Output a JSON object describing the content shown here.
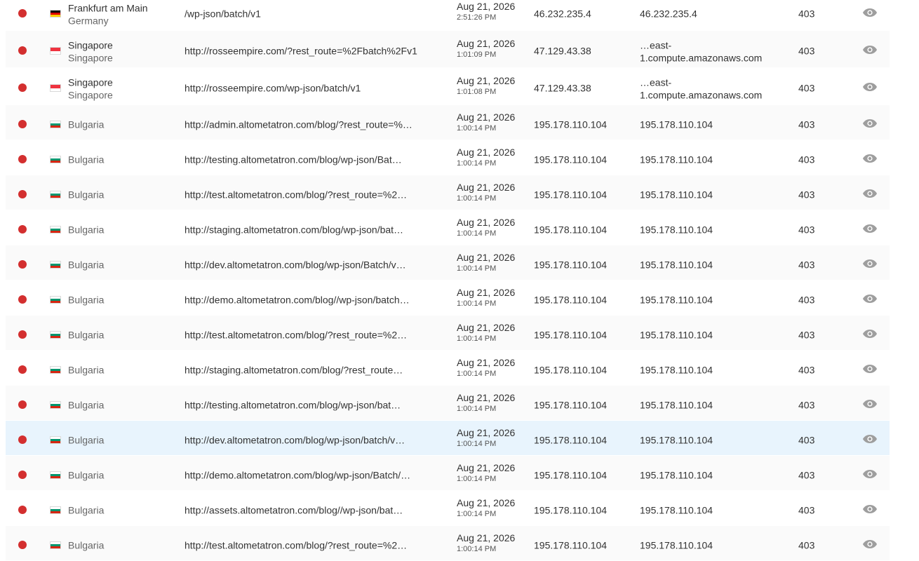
{
  "colors": {
    "status_dot": "#d32f2f",
    "highlight_row": "#e8f4fd",
    "eye_icon": "#9e9e9e"
  },
  "rows": [
    {
      "city": "Frankfurt am Main",
      "country": "Germany",
      "flag": "germany-flag-icon",
      "url": "/wp-json/batch/v1",
      "date": "Aug 21, 2026",
      "time": "2:51:26 PM",
      "ip": "46.232.235.4",
      "host": [
        "46.232.235.4"
      ],
      "code": "403"
    },
    {
      "city": "Singapore",
      "country": "Singapore",
      "flag": "singapore-flag-icon",
      "url": "http://rosseempire.com/?rest_route=%2Fbatch%2Fv1",
      "date": "Aug 21, 2026",
      "time": "1:01:09 PM",
      "ip": "47.129.43.38",
      "host": [
        "…east-",
        "1.compute.amazonaws.com"
      ],
      "code": "403"
    },
    {
      "city": "Singapore",
      "country": "Singapore",
      "flag": "singapore-flag-icon",
      "url": "http://rosseempire.com/wp-json/batch/v1",
      "date": "Aug 21, 2026",
      "time": "1:01:08 PM",
      "ip": "47.129.43.38",
      "host": [
        "…east-",
        "1.compute.amazonaws.com"
      ],
      "code": "403"
    },
    {
      "city": "",
      "country": "Bulgaria",
      "flag": "bulgaria-flag-icon",
      "url": "http://admin.altometatron.com/blog/?rest_route=%…",
      "date": "Aug 21, 2026",
      "time": "1:00:14 PM",
      "ip": "195.178.110.104",
      "host": [
        "195.178.110.104"
      ],
      "code": "403"
    },
    {
      "city": "",
      "country": "Bulgaria",
      "flag": "bulgaria-flag-icon",
      "url": "http://testing.altometatron.com/blog/wp-json/Bat…",
      "date": "Aug 21, 2026",
      "time": "1:00:14 PM",
      "ip": "195.178.110.104",
      "host": [
        "195.178.110.104"
      ],
      "code": "403"
    },
    {
      "city": "",
      "country": "Bulgaria",
      "flag": "bulgaria-flag-icon",
      "url": "http://test.altometatron.com/blog/?rest_route=%2…",
      "date": "Aug 21, 2026",
      "time": "1:00:14 PM",
      "ip": "195.178.110.104",
      "host": [
        "195.178.110.104"
      ],
      "code": "403"
    },
    {
      "city": "",
      "country": "Bulgaria",
      "flag": "bulgaria-flag-icon",
      "url": "http://staging.altometatron.com/blog/wp-json/bat…",
      "date": "Aug 21, 2026",
      "time": "1:00:14 PM",
      "ip": "195.178.110.104",
      "host": [
        "195.178.110.104"
      ],
      "code": "403"
    },
    {
      "city": "",
      "country": "Bulgaria",
      "flag": "bulgaria-flag-icon",
      "url": "http://dev.altometatron.com/blog/wp-json/Batch/v…",
      "date": "Aug 21, 2026",
      "time": "1:00:14 PM",
      "ip": "195.178.110.104",
      "host": [
        "195.178.110.104"
      ],
      "code": "403"
    },
    {
      "city": "",
      "country": "Bulgaria",
      "flag": "bulgaria-flag-icon",
      "url": "http://demo.altometatron.com/blog//wp-json/batch…",
      "date": "Aug 21, 2026",
      "time": "1:00:14 PM",
      "ip": "195.178.110.104",
      "host": [
        "195.178.110.104"
      ],
      "code": "403"
    },
    {
      "city": "",
      "country": "Bulgaria",
      "flag": "bulgaria-flag-icon",
      "url": "http://test.altometatron.com/blog/?rest_route=%2…",
      "date": "Aug 21, 2026",
      "time": "1:00:14 PM",
      "ip": "195.178.110.104",
      "host": [
        "195.178.110.104"
      ],
      "code": "403"
    },
    {
      "city": "",
      "country": "Bulgaria",
      "flag": "bulgaria-flag-icon",
      "url": "http://staging.altometatron.com/blog/?rest_route…",
      "date": "Aug 21, 2026",
      "time": "1:00:14 PM",
      "ip": "195.178.110.104",
      "host": [
        "195.178.110.104"
      ],
      "code": "403"
    },
    {
      "city": "",
      "country": "Bulgaria",
      "flag": "bulgaria-flag-icon",
      "url": "http://testing.altometatron.com/blog/wp-json/bat…",
      "date": "Aug 21, 2026",
      "time": "1:00:14 PM",
      "ip": "195.178.110.104",
      "host": [
        "195.178.110.104"
      ],
      "code": "403"
    },
    {
      "city": "",
      "country": "Bulgaria",
      "flag": "bulgaria-flag-icon",
      "url": "http://dev.altometatron.com/blog/wp-json/batch/v…",
      "date": "Aug 21, 2026",
      "time": "1:00:14 PM",
      "ip": "195.178.110.104",
      "host": [
        "195.178.110.104"
      ],
      "code": "403",
      "highlighted": true
    },
    {
      "city": "",
      "country": "Bulgaria",
      "flag": "bulgaria-flag-icon",
      "url": "http://demo.altometatron.com/blog/wp-json/Batch/…",
      "date": "Aug 21, 2026",
      "time": "1:00:14 PM",
      "ip": "195.178.110.104",
      "host": [
        "195.178.110.104"
      ],
      "code": "403"
    },
    {
      "city": "",
      "country": "Bulgaria",
      "flag": "bulgaria-flag-icon",
      "url": "http://assets.altometatron.com/blog//wp-json/bat…",
      "date": "Aug 21, 2026",
      "time": "1:00:14 PM",
      "ip": "195.178.110.104",
      "host": [
        "195.178.110.104"
      ],
      "code": "403"
    },
    {
      "city": "",
      "country": "Bulgaria",
      "flag": "bulgaria-flag-icon",
      "url": "http://test.altometatron.com/blog/?rest_route=%2…",
      "date": "Aug 21, 2026",
      "time": "1:00:14 PM",
      "ip": "195.178.110.104",
      "host": [
        "195.178.110.104"
      ],
      "code": "403"
    }
  ]
}
